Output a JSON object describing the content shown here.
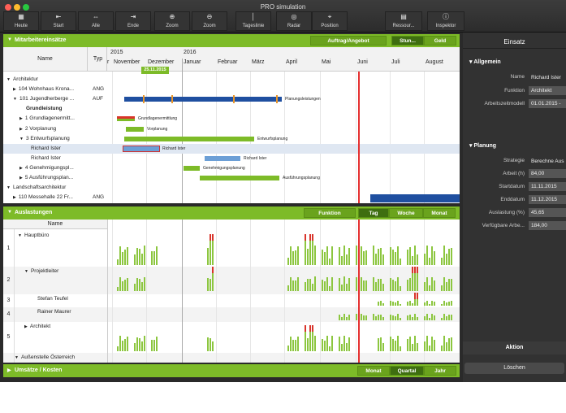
{
  "window": {
    "title": "PRO simulation"
  },
  "toolbar": [
    {
      "label": "Heute",
      "icon": "calendar-icon",
      "glyph": "▦"
    },
    {
      "label": "Start",
      "icon": "start-icon",
      "glyph": "⇤"
    },
    {
      "label": "Alle",
      "icon": "all-icon",
      "glyph": "⇔"
    },
    {
      "label": "Ende",
      "icon": "end-icon",
      "glyph": "⇥"
    },
    {
      "label": "Zoom",
      "icon": "zoom-in-icon",
      "glyph": "⊕"
    },
    {
      "label": "Zoom",
      "icon": "zoom-out-icon",
      "glyph": "⊖"
    },
    {
      "label": "Tageslinie",
      "icon": "dayline-icon",
      "glyph": "│"
    },
    {
      "label": "Radar",
      "icon": "radar-icon",
      "glyph": "◎"
    },
    {
      "label": "Position",
      "icon": "position-icon",
      "glyph": "⌖"
    },
    {
      "label": "Ressour...",
      "icon": "resources-icon",
      "glyph": "▤"
    },
    {
      "label": "Inspektor",
      "icon": "inspector-icon",
      "glyph": "ⓘ"
    }
  ],
  "mitarbeiter": {
    "title": "Mitarbeitereinsätze",
    "buttons": [
      "Auftrag/Angebot",
      "Stun...",
      "Geld"
    ],
    "col_name": "Name",
    "col_typ": "Typ",
    "years": [
      "2015",
      "2016"
    ],
    "months": [
      "r",
      "November",
      "Dezember",
      "Januar",
      "Februar",
      "März",
      "April",
      "Mai",
      "Juni",
      "Juli",
      "August"
    ],
    "today": "25.11.2015",
    "rows": [
      {
        "name": "Architektur",
        "typ": "",
        "arrow": "▼",
        "bold": false
      },
      {
        "name": "104 Wohnhaus Krona...",
        "typ": "ANG",
        "arrow": "▶",
        "bold": false
      },
      {
        "name": "101 Jugendherberge ...",
        "typ": "AUF",
        "arrow": "▼",
        "bold": false
      },
      {
        "name": "Grundleistung",
        "typ": "",
        "arrow": "",
        "bold": true
      },
      {
        "name": "1 Grundlagenermitt...",
        "typ": "",
        "arrow": "▶",
        "bold": false
      },
      {
        "name": "2 Vorplanung",
        "typ": "",
        "arrow": "▶",
        "bold": false
      },
      {
        "name": "3 Entwurfsplanung",
        "typ": "",
        "arrow": "▼",
        "bold": false
      },
      {
        "name": "Richard Ister",
        "typ": "",
        "arrow": "",
        "bold": false
      },
      {
        "name": "Richard Ister",
        "typ": "",
        "arrow": "",
        "bold": false
      },
      {
        "name": "4 Genehmigungspl...",
        "typ": "",
        "arrow": "▶",
        "bold": false
      },
      {
        "name": "5 Ausführungsplan...",
        "typ": "",
        "arrow": "▶",
        "bold": false
      },
      {
        "name": "Landschaftsarchitektur",
        "typ": "",
        "arrow": "▼",
        "bold": false
      },
      {
        "name": "110 Messehalle 22 Fr...",
        "typ": "ANG",
        "arrow": "▶",
        "bold": false
      }
    ],
    "bar_labels": [
      "Planungsleistungen",
      "Grundlagenermittlung",
      "Vorplanung",
      "Entwurfsplanung",
      "Richard Ister",
      "Richard Ister",
      "Genehmigungsplanung",
      "Ausführungsplanung"
    ]
  },
  "auslastungen": {
    "title": "Auslastungen",
    "buttons": [
      "Funktion",
      "Tag",
      "Woche",
      "Monat"
    ],
    "col_name": "Name",
    "rows": [
      {
        "num": "1",
        "name": "Hauptbüro",
        "arrow": "▼"
      },
      {
        "num": "2",
        "name": "Projektleiter",
        "arrow": "▼"
      },
      {
        "num": "3",
        "name": "Stefan Teufel",
        "arrow": ""
      },
      {
        "num": "4",
        "name": "Rainer Maurer",
        "arrow": ""
      },
      {
        "num": "5",
        "name": "Architekt",
        "arrow": "▶"
      },
      {
        "num": "",
        "name": "Außenstelle Österreich",
        "arrow": "▼"
      }
    ]
  },
  "umsaetze": {
    "title": "Umsätze / Kosten",
    "buttons": [
      "Monat",
      "Quartal",
      "Jahr"
    ]
  },
  "inspector": {
    "title": "Einsatz",
    "allgemein": "Allgemein",
    "name_label": "Name",
    "name_value": "Richard Ister",
    "funktion_label": "Funktion",
    "funktion_value": "Architekt",
    "azm_label": "Arbeitszeitmodell",
    "azm_value": "01.01.2015 -",
    "planung": "Planung",
    "strategie_label": "Strategie",
    "strategie_value": "Berechne Aus",
    "arbeit_label": "Arbeit (h)",
    "arbeit_value": "84,00",
    "start_label": "Startdatum",
    "start_value": "11.11.2015",
    "end_label": "Enddatum",
    "end_value": "11.12.2015",
    "ausl_label": "Auslastung (%)",
    "ausl_value": "45,65",
    "verf_label": "Verfügbare Arbe...",
    "verf_value": "184,00",
    "aktion": "Aktion",
    "loeschen": "Löschen"
  },
  "colors": {
    "green": "#7dbb28",
    "blue": "#1f4fa0",
    "red": "#d9342b",
    "today_line": "#e53030"
  }
}
